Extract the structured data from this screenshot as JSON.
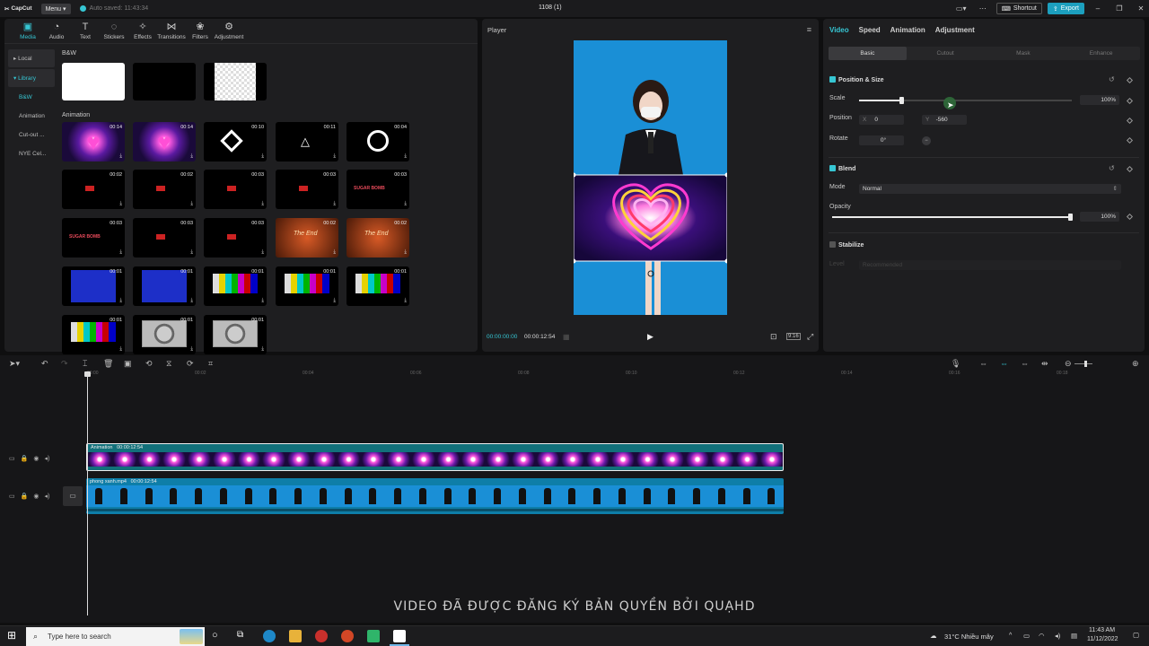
{
  "titlebar": {
    "app_name": "CapCut",
    "menu_label": "Menu",
    "autosave": "Auto saved: 11:43:34",
    "project_title": "1108 (1)",
    "shortcut_label": "Shortcut",
    "export_label": "Export"
  },
  "media": {
    "tabs": [
      {
        "label": "Media",
        "icon": "media-icon"
      },
      {
        "label": "Audio",
        "icon": "audio-icon"
      },
      {
        "label": "Text",
        "icon": "text-icon"
      },
      {
        "label": "Stickers",
        "icon": "stickers-icon"
      },
      {
        "label": "Effects",
        "icon": "effects-icon"
      },
      {
        "label": "Transitions",
        "icon": "transitions-icon"
      },
      {
        "label": "Filters",
        "icon": "filters-icon"
      },
      {
        "label": "Adjustment",
        "icon": "adjustment-icon"
      }
    ],
    "sidebar": {
      "local": "Local",
      "library": "Library",
      "bw": "B&W",
      "animation": "Animation",
      "cutout": "Cut-out ...",
      "nye": "NYE Cel..."
    },
    "section_bw": "B&W",
    "section_animation": "Animation",
    "durations": {
      "r1": [
        "00:14",
        "00:14",
        "00:10",
        "00:11",
        "00:04"
      ],
      "r2": [
        "00:02",
        "00:02",
        "00:03",
        "00:03",
        "00:03"
      ],
      "r3": [
        "00:03",
        "00:03",
        "00:03",
        "00:02",
        "00:02"
      ],
      "r4": [
        "00:01",
        "00:01",
        "00:01",
        "00:01",
        "00:01"
      ],
      "r5": [
        "00:01",
        "00:01",
        "00:01"
      ]
    },
    "sugar_bomb": "SUGAR BOMB",
    "the_end": "The End"
  },
  "player": {
    "title": "Player",
    "time_current": "00:00:00:00",
    "time_total": "00:00:12:54"
  },
  "inspector": {
    "tabs": [
      "Video",
      "Speed",
      "Animation",
      "Adjustment"
    ],
    "subtabs": [
      "Basic",
      "Cutout",
      "Mask",
      "Enhance"
    ],
    "position_size": "Position & Size",
    "scale_label": "Scale",
    "scale_value": "100%",
    "scale_fraction": 0.2,
    "position_label": "Position",
    "x_label": "X",
    "x_value": "0",
    "y_label": "Y",
    "y_value": "-560",
    "rotate_label": "Rotate",
    "rotate_value": "0°",
    "blend": "Blend",
    "mode_label": "Mode",
    "mode_value": "Normal",
    "opacity_label": "Opacity",
    "opacity_value": "100%",
    "opacity_fraction": 1.0,
    "stabilize": "Stabilize",
    "level_label": "Level",
    "level_value": "Recommended"
  },
  "timeline": {
    "ruler": [
      "00:00",
      "00:02",
      "00:04",
      "00:06",
      "00:08",
      "00:10",
      "00:12",
      "00:14",
      "00:16",
      "00:18"
    ],
    "track1_name": "Animation",
    "track1_duration": "00:00:12:54",
    "track2_name": "phong xanh.mp4",
    "track2_duration": "00:00:12:54"
  },
  "watermark": "VIDEO ĐÃ ĐƯỢC ĐĂNG KÝ BẢN QUYỀN BỞI QUẠHD",
  "taskbar": {
    "search_placeholder": "Type here to search",
    "weather": "31°C  Nhiều mây",
    "time": "11:43 AM",
    "date": "11/12/2022"
  }
}
